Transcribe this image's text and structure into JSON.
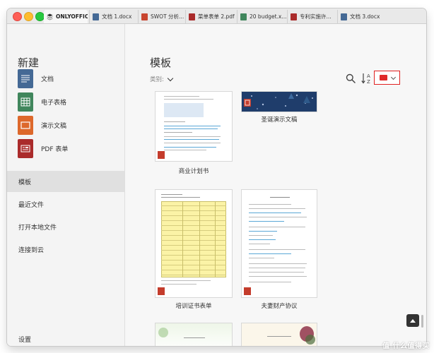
{
  "tabs": [
    {
      "label": "ONLYOFFICE",
      "icon": "onlyoffice-logo-icon",
      "active": true
    },
    {
      "label": "文档 1.docx",
      "icon": "document-icon"
    },
    {
      "label": "SWOT 分析...",
      "icon": "presentation-icon"
    },
    {
      "label": "菜单表单 2.pdf",
      "icon": "pdf-icon"
    },
    {
      "label": "20 budget.x...",
      "icon": "spreadsheet-icon"
    },
    {
      "label": "专利实施许...",
      "icon": "pdf-icon"
    },
    {
      "label": "文档 3.docx",
      "icon": "document-icon"
    }
  ],
  "sidebar": {
    "create_title": "新建",
    "create_items": [
      {
        "label": "文档",
        "icon": "document-icon",
        "color": "#446995"
      },
      {
        "label": "电子表格",
        "icon": "spreadsheet-icon",
        "color": "#40865c"
      },
      {
        "label": "演示文稿",
        "icon": "presentation-icon",
        "color": "#dd682b"
      },
      {
        "label": "PDF 表单",
        "icon": "pdf-form-icon",
        "color": "#aa2b2b"
      }
    ],
    "nav_items": [
      {
        "label": "模板",
        "active": true
      },
      {
        "label": "最近文件"
      },
      {
        "label": "打开本地文件"
      },
      {
        "label": "连接到云"
      }
    ],
    "settings_label": "设置"
  },
  "main": {
    "title": "模板",
    "category_label": "类别:",
    "language_flag_color": "#e02a2a",
    "templates": [
      {
        "label": "商业计划书"
      },
      {
        "label": "圣诞演示文稿"
      },
      {
        "label": "培训证书表单"
      },
      {
        "label": "夫妻财产协议"
      }
    ]
  },
  "watermark": "值 什么值得买"
}
